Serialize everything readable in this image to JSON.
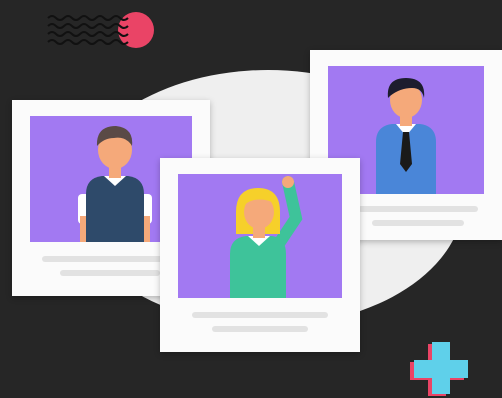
{
  "illustration": {
    "subject": "profile-photo-cards",
    "colors": {
      "background": "#262626",
      "blob": "#efefef",
      "card": "#fbfbfb",
      "photo_bg": "#a279f2",
      "caption_line": "#e2e2e2",
      "stamp_circle": "#ea4466",
      "plus_blue": "#5fd0ea",
      "plus_pink": "#ea4466",
      "skin": "#f5a97a",
      "hair_dark": "#1d1d2e",
      "hair_brown": "#5a4a46",
      "hair_blonde": "#f6d02a",
      "shirt_blue": "#4a86d8",
      "shirt_navy": "#2e4a6a",
      "shirt_green": "#3ec39a",
      "tie": "#1a1a1a"
    },
    "cards": [
      {
        "person": "man-with-tie"
      },
      {
        "person": "young-man"
      },
      {
        "person": "woman-waving"
      }
    ],
    "decorations": [
      "wavy-lines",
      "stamp-circle",
      "plus-sign"
    ]
  }
}
